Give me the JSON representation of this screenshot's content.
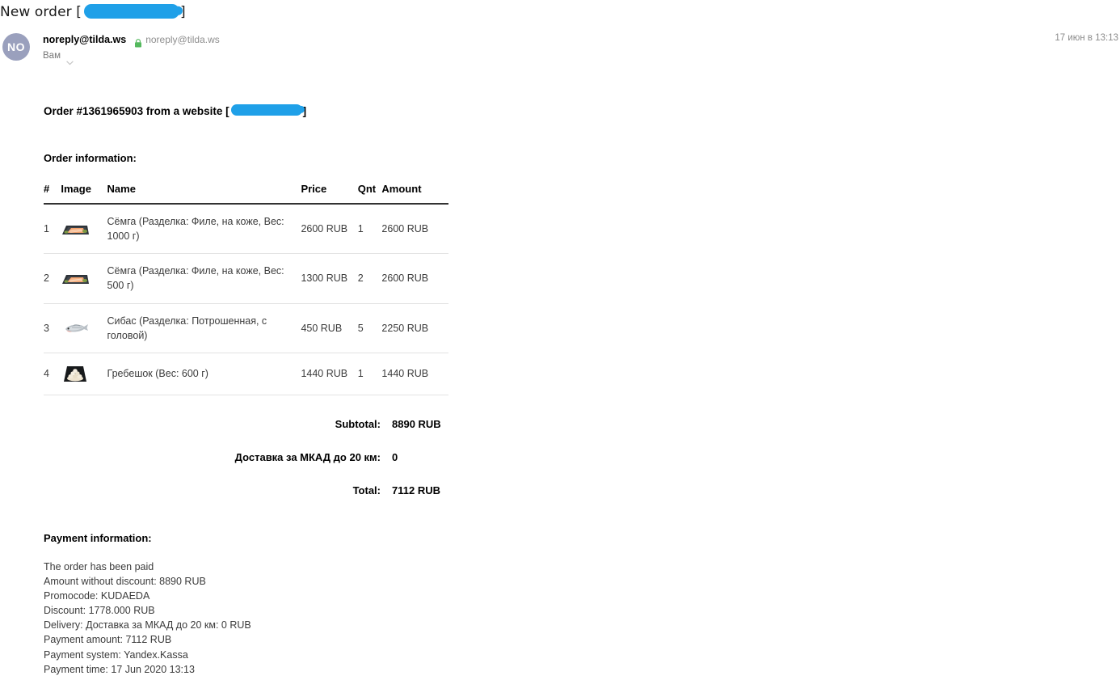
{
  "subject": {
    "text": "New order [",
    "redacted": true,
    "suffix": "]"
  },
  "sender": {
    "avatar_initials": "NO",
    "name": "noreply@tilda.ws",
    "email": "noreply@tilda.ws",
    "lock_icon": "lock-icon",
    "recipient_label": "Вам",
    "chevron_icon": "chevron-down-icon",
    "timestamp": "17 июн в 13:13"
  },
  "body": {
    "order_heading_prefix": "Order #1361965903 from a website [",
    "order_heading_suffix": "]",
    "order_info_heading": "Order information:",
    "payment_heading": "Payment information:"
  },
  "items_table": {
    "columns": [
      "#",
      "Image",
      "Name",
      "Price",
      "Qnt",
      "Amount"
    ],
    "rows": [
      {
        "index": "1",
        "image": "salmon-fillet-thumbnail",
        "name": "Сёмга (Разделка: Филе, на коже, Вес: 1000 г)",
        "price": "2600 RUB",
        "qnt": "1",
        "amount": "2600 RUB"
      },
      {
        "index": "2",
        "image": "salmon-fillet-thumbnail",
        "name": "Сёмга (Разделка: Филе, на коже, Вес: 500 г)",
        "price": "1300 RUB",
        "qnt": "2",
        "amount": "2600 RUB"
      },
      {
        "index": "3",
        "image": "seabass-thumbnail",
        "name": "Сибас (Разделка: Потрошенная, с головой)",
        "price": "450 RUB",
        "qnt": "5",
        "amount": "2250 RUB"
      },
      {
        "index": "4",
        "image": "scallop-thumbnail",
        "name": "Гребешок (Вес: 600 г)",
        "price": "1440 RUB",
        "qnt": "1",
        "amount": "1440 RUB"
      }
    ]
  },
  "totals": [
    {
      "label": "Subtotal:",
      "value": "8890 RUB"
    },
    {
      "label": "Доставка за МКАД до 20 км:",
      "value": "0"
    },
    {
      "label": "Total:",
      "value": "7112 RUB"
    }
  ],
  "payment_lines": [
    "The order has been paid",
    "Amount without discount: 8890 RUB",
    "Promocode: KUDAEDA",
    "Discount: 1778.000 RUB",
    "Delivery: Доставка за МКАД до 20 км: 0 RUB",
    "Payment amount: 7112 RUB",
    "Payment system: Yandex.Kassa",
    "Payment time: 17 Jun 2020 13:13"
  ],
  "colors": {
    "redaction": "#1fa0e8",
    "avatar_bg": "#9aa0bd",
    "lock_green": "#55b95e",
    "muted_text": "#8e8e8e"
  }
}
